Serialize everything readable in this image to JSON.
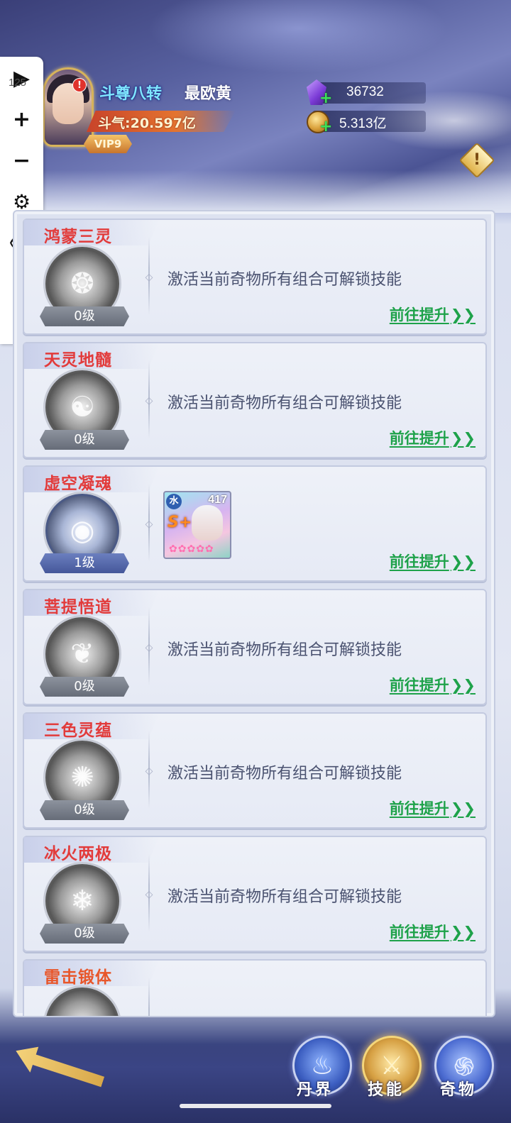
{
  "player": {
    "rank": "斗尊八转",
    "name": "最欧黄",
    "power": "斗气:20.597亿",
    "vip": "VIP9",
    "notify": "!"
  },
  "currency": {
    "gems": "36732",
    "gold": "5.313亿"
  },
  "toolbar": {
    "badge": "125"
  },
  "cards": [
    {
      "title": "鸿蒙三灵",
      "level": "0级",
      "desc": "激活当前奇物所有组合可解锁技能",
      "link": "前往提升",
      "arrow": "❯❯",
      "glyph": "❂"
    },
    {
      "title": "天灵地髓",
      "level": "0级",
      "desc": "激活当前奇物所有组合可解锁技能",
      "link": "前往提升",
      "arrow": "❯❯",
      "glyph": "☯"
    },
    {
      "title": "虚空凝魂",
      "level": "1级",
      "desc": "",
      "link": "前往提升",
      "arrow": "❯❯",
      "glyph": "◉"
    },
    {
      "title": "菩提悟道",
      "level": "0级",
      "desc": "激活当前奇物所有组合可解锁技能",
      "link": "前往提升",
      "arrow": "❯❯",
      "glyph": "❦"
    },
    {
      "title": "三色灵蕴",
      "level": "0级",
      "desc": "激活当前奇物所有组合可解锁技能",
      "link": "前往提升",
      "arrow": "❯❯",
      "glyph": "✺"
    },
    {
      "title": "冰火两极",
      "level": "0级",
      "desc": "激活当前奇物所有组合可解锁技能",
      "link": "前往提升",
      "arrow": "❯❯",
      "glyph": "❄"
    },
    {
      "title": "雷击锻体",
      "level": "",
      "desc": "",
      "link": "",
      "arrow": "",
      "glyph": ""
    }
  ],
  "hero": {
    "element": "水",
    "level": "417",
    "rank": "S+"
  },
  "nav": {
    "items": [
      "丹界",
      "技能",
      "奇物"
    ]
  }
}
